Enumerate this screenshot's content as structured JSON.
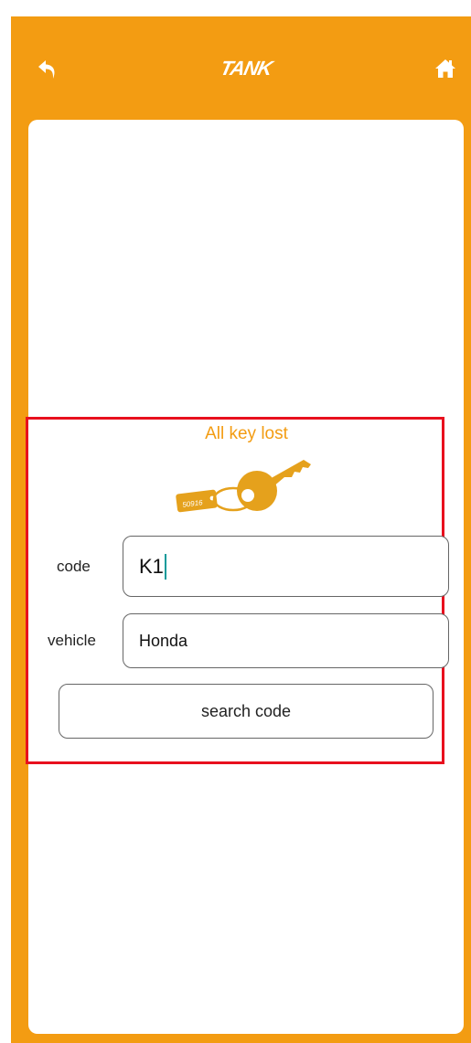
{
  "header": {
    "logo_text": "TANK",
    "back_icon": "back-arrow-icon",
    "home_icon": "home-icon"
  },
  "form": {
    "title": "All key lost",
    "key_tag_text": "50916",
    "code_label": "code",
    "code_value": "K1",
    "vehicle_label": "vehicle",
    "vehicle_value": "Honda",
    "search_button": "search code"
  },
  "colors": {
    "accent": "#f39c12",
    "highlight_border": "#e8101e",
    "key_gold": "#e5a11c",
    "caret": "#0a9a9a"
  }
}
